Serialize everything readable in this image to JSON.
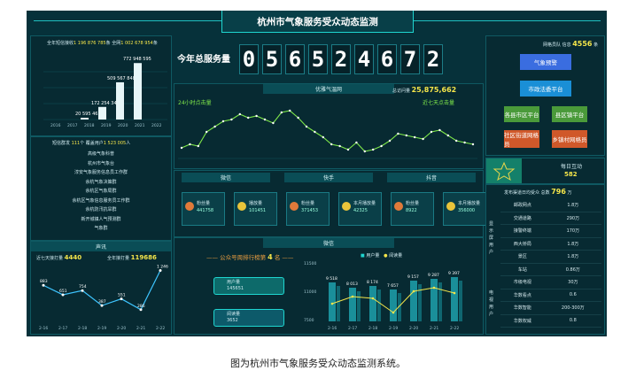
{
  "title": "杭州市气象服务受众动态监测",
  "total_label": "今年总服务量",
  "total_digits": [
    "0",
    "5",
    "6",
    "5",
    "2",
    "4",
    "6",
    "7",
    "2"
  ],
  "left_top": {
    "stat_label": "全年短信接收",
    "stat_value": "1 196 876 785",
    "stat_unit": "条",
    "stat_label2": "全网",
    "stat_value2": "1 002 678 954",
    "stat_unit2": "条",
    "bar_labels": [
      "20 595 462",
      "172 254 342",
      "509 567 848",
      "772 948 595"
    ],
    "bars": [
      20595462,
      172254342,
      509567848,
      772948595
    ],
    "x_labels": [
      "2016",
      "2017",
      "2018",
      "2019",
      "2020",
      "2021",
      "2022"
    ]
  },
  "left_mid": {
    "header_label": "短信群发",
    "header_value": "111",
    "header_unit": "个",
    "header_label2": "覆盖用户",
    "header_value2": "1 523 005",
    "header_unit2": "人",
    "items": [
      "高级气象科普",
      "杭州市气象台",
      "淳安气象服务信息员工作群",
      "余杭气象决策群",
      "余杭区气象局群",
      "余杭区气象信息服务员工作群",
      "余杭防汛抗旱群",
      "新开城镇人气预测群",
      "气象群"
    ]
  },
  "left_bot": {
    "title": "声讯",
    "left_label": "近七天接打量",
    "left_value": "4440",
    "right_label": "全年接打量",
    "right_value": "119686",
    "points": [
      883,
      651,
      754,
      387,
      551,
      286,
      1246
    ],
    "point_labels": [
      "883",
      "651",
      "754",
      "387",
      "551",
      "286",
      "1 246"
    ],
    "x_labels": [
      "2-16",
      "2-17",
      "2-18",
      "2-19",
      "2-20",
      "2-21",
      "2-22"
    ]
  },
  "center": {
    "weather_title": "优雅气温网",
    "weather_total_label": "总访问量",
    "weather_total": "25,875,662",
    "chart_left_title": "24小时点击量",
    "chart_right_title": "近七天点击量",
    "wechat_label": "微信",
    "douyin_label": "抖音",
    "kuaishou_label": "快手",
    "cards": [
      {
        "name": "粉丝量",
        "value": "441758"
      },
      {
        "name": "播放量",
        "value": "101451"
      },
      {
        "name": "粉丝量",
        "value": "371453"
      },
      {
        "name": "本月播放量",
        "value": "42325"
      },
      {
        "name": "粉丝量",
        "value": "8922"
      },
      {
        "name": "本月播放量",
        "value": "356000"
      }
    ],
    "weixin_title": "微信",
    "rank_label": "公众号周排行榜第",
    "rank_value": "4",
    "rank_unit": "名",
    "legend_users": "用户量",
    "legend_reads": "阅读量",
    "users_label": "用户量",
    "users_value": "145651",
    "reads_label": "阅读量",
    "reads_value": "3652",
    "bar_y_labels": [
      "11500",
      "11000",
      "7500"
    ],
    "bar_x_labels": [
      "2-16",
      "2-17",
      "2-18",
      "2-19",
      "2-20",
      "2-21",
      "2-22"
    ],
    "bar_top_labels": [
      "9 518",
      "8 013",
      "8 174",
      "7 657",
      "9 157",
      "9 287",
      "9 397"
    ]
  },
  "right": {
    "title": "网格员队",
    "count_label": "信息",
    "count_value": "4556",
    "count_unit": "条",
    "flow": [
      "气象预警",
      "市政法委平台",
      "各县市区平台",
      "县区镇平台",
      "社区街道网格员",
      "乡镇村网格员"
    ],
    "daily_label": "每日互动",
    "daily_value": "582",
    "table_title": "发布渠道日均受众",
    "table_total_label": "总数",
    "table_total": "796",
    "table_total_unit": "万",
    "side_a": "显示屏用户",
    "side_b": "电视用户",
    "rows": [
      {
        "name": "邮政网点",
        "value": "1.8万"
      },
      {
        "name": "交通道路",
        "value": "290万"
      },
      {
        "name": "接警终端",
        "value": "170万"
      },
      {
        "name": "西大桥局",
        "value": "1.8万"
      },
      {
        "name": "景区",
        "value": "1.8万"
      },
      {
        "name": "车站",
        "value": "0.86万"
      },
      {
        "name": "市级电视",
        "value": "30万"
      },
      {
        "name": "华数看点",
        "value": "0.6"
      },
      {
        "name": "华数智能",
        "value": "200-300万"
      },
      {
        "name": "华数权威",
        "value": "0.8"
      }
    ]
  },
  "caption": "图为杭州市气象服务受众动态监测系统。"
}
